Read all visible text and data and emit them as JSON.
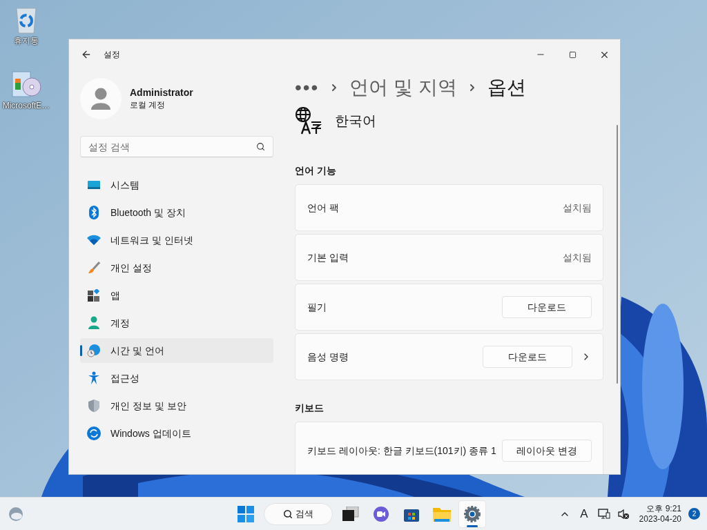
{
  "desktop_icons": [
    {
      "label": "휴지통",
      "kind": "recycle"
    },
    {
      "label": "MicrosoftE…",
      "kind": "installer"
    }
  ],
  "window": {
    "title": "설정",
    "breadcrumb": [
      {
        "label": "•••",
        "kind": "more"
      },
      {
        "label": "언어 및 지역",
        "kind": "parent"
      },
      {
        "label": "옵션",
        "kind": "current"
      }
    ]
  },
  "user": {
    "name": "Administrator",
    "subtitle": "로컬 계정"
  },
  "search": {
    "placeholder": "설정 검색"
  },
  "nav_items": [
    {
      "label": "시스템",
      "kind": "system",
      "selected": false
    },
    {
      "label": "Bluetooth 및 장치",
      "kind": "bluetooth",
      "selected": false
    },
    {
      "label": "네트워크 및 인터넷",
      "kind": "network",
      "selected": false
    },
    {
      "label": "개인 설정",
      "kind": "brush",
      "selected": false
    },
    {
      "label": "앱",
      "kind": "apps",
      "selected": false
    },
    {
      "label": "계정",
      "kind": "account",
      "selected": false
    },
    {
      "label": "시간 및 언어",
      "kind": "time",
      "selected": true
    },
    {
      "label": "접근성",
      "kind": "accessibility",
      "selected": false
    },
    {
      "label": "개인 정보 및 보안",
      "kind": "shield",
      "selected": false
    },
    {
      "label": "Windows 업데이트",
      "kind": "update",
      "selected": false
    }
  ],
  "language": {
    "name": "한국어"
  },
  "sections": [
    {
      "title": "언어 기능",
      "rows": [
        {
          "label": "언어 팩",
          "kind": "status",
          "value": "설치됨"
        },
        {
          "label": "기본 입력",
          "kind": "status",
          "value": "설치됨"
        },
        {
          "label": "필기",
          "kind": "button",
          "button": "다운로드"
        },
        {
          "label": "음성 명령",
          "kind": "button_chevron",
          "button": "다운로드"
        }
      ]
    },
    {
      "title": "키보드",
      "rows": [
        {
          "label": "키보드 레이아웃: 한글 키보드(101키) 종류 1",
          "kind": "button",
          "button": "레이아웃 변경"
        }
      ]
    }
  ],
  "taskbar": {
    "search": "검색",
    "apps": [
      {
        "kind": "start",
        "active": false
      },
      {
        "kind": "taskview",
        "active": false
      },
      {
        "kind": "chat",
        "active": false
      },
      {
        "kind": "store",
        "active": false
      },
      {
        "kind": "explorer",
        "active": false
      },
      {
        "kind": "settings",
        "active": true
      }
    ],
    "ime": "A",
    "time": "오후 9:21",
    "date": "2023-04-20",
    "notifications": "2"
  }
}
